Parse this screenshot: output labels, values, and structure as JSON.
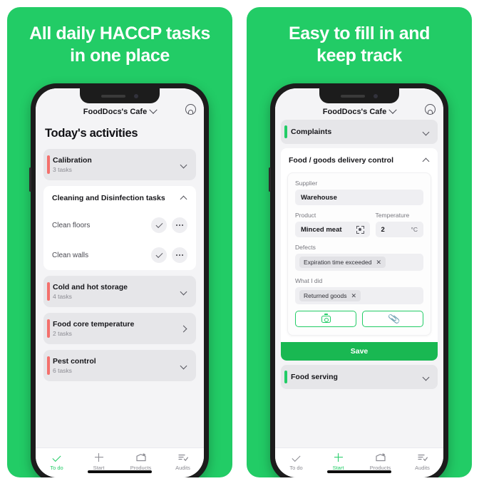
{
  "theme": {
    "brand_green": "#22cc66",
    "accent_red": "#f4706c",
    "save_green": "#19b852"
  },
  "panels": [
    {
      "headline": "All daily HACCP tasks in one place",
      "headline_line1": "All daily HACCP tasks",
      "headline_line2": "in one place",
      "app": {
        "venue": "FoodDocs's Cafe",
        "page_title": "Today's activities",
        "items": [
          {
            "type": "collapsed",
            "name": "Calibration",
            "sub": "3 tasks",
            "accent": "red",
            "chevron": "down"
          },
          {
            "type": "group",
            "name": "Cleaning and Disinfection tasks",
            "chevron": "up",
            "rows": [
              {
                "label": "Clean floors"
              },
              {
                "label": "Clean walls"
              }
            ]
          },
          {
            "type": "collapsed",
            "name": "Cold and hot storage",
            "sub": "4 tasks",
            "accent": "red",
            "chevron": "down"
          },
          {
            "type": "collapsed",
            "name": "Food core temperature",
            "sub": "2 tasks",
            "accent": "red",
            "chevron": "right"
          },
          {
            "type": "collapsed",
            "name": "Pest control",
            "sub": "6 tasks",
            "accent": "red",
            "chevron": "down"
          }
        ],
        "tabs": [
          {
            "label": "To do",
            "icon": "check-icon",
            "active": true
          },
          {
            "label": "Start",
            "icon": "plus-icon",
            "active": false
          },
          {
            "label": "Products",
            "icon": "products-box-icon",
            "active": false
          },
          {
            "label": "Audits",
            "icon": "audits-list-check-icon",
            "active": false
          }
        ]
      }
    },
    {
      "headline": "Easy to fill in and keep track",
      "headline_line1": "Easy to fill in and",
      "headline_line2": "keep track",
      "app": {
        "venue": "FoodDocs's Cafe",
        "accordion_top": {
          "name": "Complaints",
          "accent": "green",
          "chevron": "down"
        },
        "accordion_open": {
          "name": "Food / goods delivery control",
          "chevron": "up"
        },
        "form": {
          "supplier_label": "Supplier",
          "supplier_value": "Warehouse",
          "product_label": "Product",
          "product_value": "Minced meat",
          "temperature_label": "Temperature",
          "temperature_value": "2",
          "temperature_unit": "°C",
          "defects_label": "Defects",
          "defects_chip": "Expiration time exceeded",
          "chip_remove": "✕",
          "what_i_did_label": "What I did",
          "what_i_did_chip": "Returned goods",
          "photo_button_icon": "camera-icon",
          "attach_button_icon": "paperclip-icon",
          "save_label": "Save"
        },
        "accordion_bottom": {
          "name": "Food serving",
          "accent": "green",
          "chevron": "down"
        },
        "tabs": [
          {
            "label": "To do",
            "icon": "check-icon",
            "active": false
          },
          {
            "label": "Start",
            "icon": "plus-icon",
            "active": true
          },
          {
            "label": "Products",
            "icon": "products-box-icon",
            "active": false
          },
          {
            "label": "Audits",
            "icon": "audits-list-check-icon",
            "active": false
          }
        ]
      }
    }
  ]
}
